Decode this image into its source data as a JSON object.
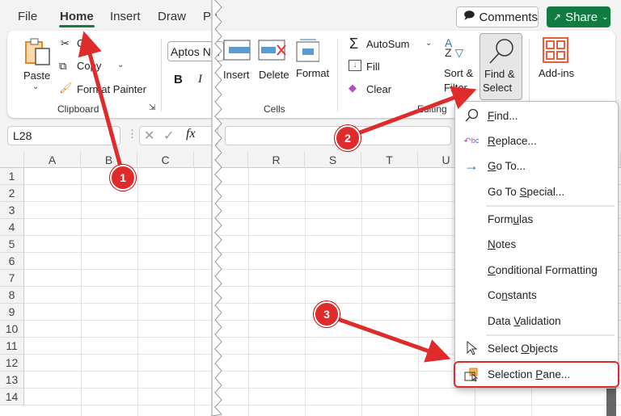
{
  "tabs": [
    "File",
    "Home",
    "Insert",
    "Draw",
    "Pa"
  ],
  "active_tab": "Home",
  "comments_label": "Comments",
  "share_label": "Share",
  "clipboard": {
    "paste": "Paste",
    "cut": "Cut",
    "copy": "Copy",
    "format_painter": "Format Painter",
    "group": "Clipboard"
  },
  "font": {
    "name": "Aptos Nar",
    "bold": "B",
    "italic": "I"
  },
  "cells": {
    "insert": "Insert",
    "delete": "Delete",
    "format": "Format",
    "group": "Cells"
  },
  "editing": {
    "autosum": "AutoSum",
    "fill": "Fill",
    "clear": "Clear",
    "sort_line1": "Sort &",
    "sort_line2": "Filter",
    "find_line1": "Find &",
    "find_line2": "Select",
    "group": "Editing"
  },
  "addins": "Add-ins",
  "name_box": "L28",
  "fx": "fx",
  "columns": [
    "A",
    "B",
    "C",
    "R",
    "S",
    "T",
    "U"
  ],
  "rows": [
    "1",
    "2",
    "3",
    "4",
    "5",
    "6",
    "7",
    "8",
    "9",
    "10",
    "11",
    "12",
    "13",
    "14"
  ],
  "menu": {
    "find": {
      "pre": "",
      "u": "F",
      "post": "ind..."
    },
    "replace": {
      "pre": "",
      "u": "R",
      "post": "eplace..."
    },
    "goto": {
      "pre": "",
      "u": "G",
      "post": "o To..."
    },
    "goto_special": {
      "pre": "Go To ",
      "u": "S",
      "post": "pecial..."
    },
    "formulas": {
      "pre": "Form",
      "u": "u",
      "post": "las"
    },
    "notes": {
      "pre": "",
      "u": "N",
      "post": "otes"
    },
    "cond": {
      "pre": "",
      "u": "C",
      "post": "onditional Formatting"
    },
    "constants": {
      "pre": "Co",
      "u": "n",
      "post": "stants"
    },
    "validation": {
      "pre": "Data ",
      "u": "V",
      "post": "alidation"
    },
    "select_objects": {
      "pre": "Select ",
      "u": "O",
      "post": "bjects"
    },
    "selection_pane": {
      "pre": "Selection ",
      "u": "P",
      "post": "ane..."
    }
  },
  "steps": [
    "1",
    "2",
    "3"
  ],
  "colors": {
    "accent": "#107c41",
    "callout": "#e02b2b"
  }
}
